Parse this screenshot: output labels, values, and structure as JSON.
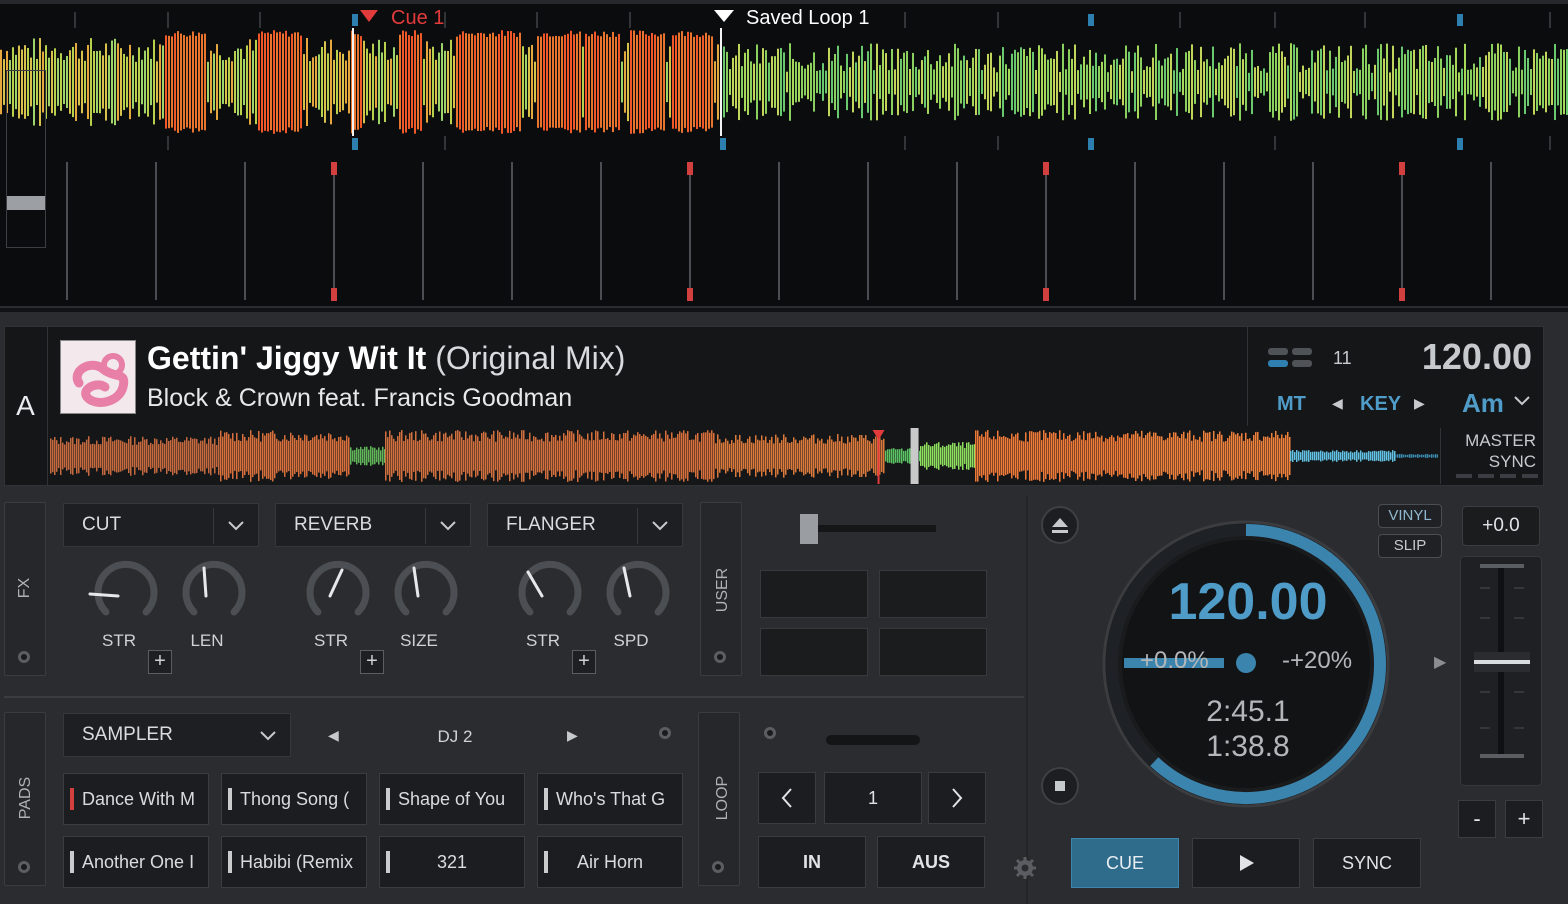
{
  "markers": {
    "cue_label": "Cue 1",
    "loop_label_1": "Saved",
    "loop_label_2": "Loop 1"
  },
  "deck": {
    "letter": "A",
    "title": "Gettin' Jiggy Wit It",
    "mix": "(Original Mix)",
    "artist": "Block & Crown feat. Francis Goodman",
    "beats": "11",
    "bpm": "120.00",
    "mt_label": "MT",
    "key_label": "KEY",
    "key_value": "Am",
    "master_label": "MASTER",
    "sync_label": "SYNC",
    "track_progress": 0.62
  },
  "fx": {
    "tab_label": "FX",
    "slots": [
      {
        "effect": "CUT",
        "knob1": "STR",
        "knob2": "LEN"
      },
      {
        "effect": "REVERB",
        "knob1": "STR",
        "knob2": "SIZE"
      },
      {
        "effect": "FLANGER",
        "knob1": "STR",
        "knob2": "SPD"
      }
    ],
    "plus": "+"
  },
  "user": {
    "tab_label": "USER"
  },
  "pads": {
    "tab_label": "PADS",
    "mode": "SAMPLER",
    "bank": "DJ 2",
    "samples": [
      "Dance With M",
      "Thong Song (",
      "Shape of You",
      "Who's That G",
      "Another One I",
      "Habibi (Remix",
      "321",
      "Air Horn"
    ]
  },
  "loop": {
    "tab_label": "LOOP",
    "size": "1",
    "in_label": "IN",
    "out_label": "AUS"
  },
  "jog": {
    "bpm": "120.00",
    "pitch": "+0.0%",
    "range": "-+20%",
    "elapsed": "2:45.1",
    "remaining": "1:38.8",
    "vinyl_label": "VINYL",
    "slip_label": "SLIP"
  },
  "pitch_fader": {
    "value": "+0.0",
    "minus": "-",
    "plus": "+"
  },
  "transport": {
    "cue_label": "CUE",
    "sync_label": "SYNC"
  },
  "colors": {
    "accent": "#4f9cc8",
    "cue_active": "#2f6c8c",
    "marker_red": "#e23b3b"
  }
}
